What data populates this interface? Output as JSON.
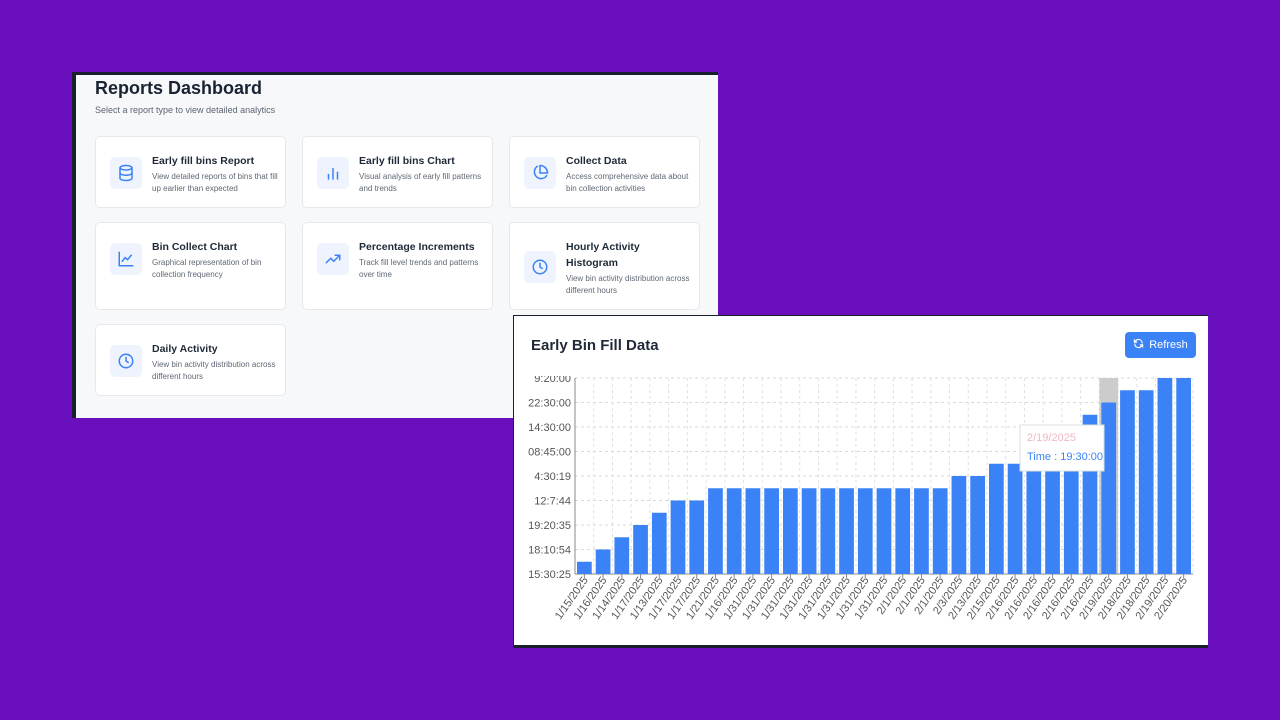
{
  "reports": {
    "title": "Reports Dashboard",
    "subtitle": "Select a report type to view detailed analytics",
    "cards": [
      {
        "title": "Early fill bins Report",
        "desc": "View detailed reports of bins that fill up earlier than expected",
        "icon": "database-icon"
      },
      {
        "title": "Early fill bins Chart",
        "desc": "Visual analysis of early fill patterns and trends",
        "icon": "bar-chart-icon"
      },
      {
        "title": "Collect Data",
        "desc": "Access comprehensive data about bin collection activities",
        "icon": "pie-chart-icon"
      },
      {
        "title": "Bin Collect Chart",
        "desc": "Graphical representation of bin collection frequency",
        "icon": "line-chart-icon"
      },
      {
        "title": "Percentage Increments",
        "desc": "Track fill level trends and patterns over time",
        "icon": "trending-up-icon"
      },
      {
        "title": "Hourly Activity Histogram",
        "desc": "View bin activity distribution across different hours",
        "icon": "clock-icon"
      },
      {
        "title": "Daily Activity",
        "desc": "View bin activity distribution across different hours",
        "icon": "clock-icon"
      }
    ]
  },
  "chart_panel": {
    "title": "Early Bin Fill Data",
    "refresh_label": "Refresh",
    "refresh_icon": "refresh-icon",
    "tooltip": {
      "date": "2/19/2025",
      "label": "Time : 19:30:00"
    }
  },
  "colors": {
    "bar": "#3b82f6",
    "accent": "#3b82f6",
    "background": "#6a0fbd"
  },
  "chart_data": {
    "type": "bar",
    "title": "Early Bin Fill Data",
    "y_tick_labels": [
      "15:30:25",
      "18:10:54",
      "19:20:35",
      "12:7:44",
      "4:30:19",
      "08:45:00",
      "14:30:00",
      "22:30:00",
      "9:20:00"
    ],
    "categories": [
      "1/15/2025",
      "1/16/2025",
      "1/14/2025",
      "1/17/2025",
      "1/13/2025",
      "1/17/2025",
      "1/17/2025",
      "1/21/2025",
      "1/16/2025",
      "1/31/2025",
      "1/31/2025",
      "1/31/2025",
      "1/31/2025",
      "1/31/2025",
      "1/31/2025",
      "1/31/2025",
      "1/31/2025",
      "2/1/2025",
      "2/1/2025",
      "2/1/2025",
      "2/3/2025",
      "2/13/2025",
      "2/15/2025",
      "2/16/2025",
      "2/16/2025",
      "2/16/2025",
      "2/16/2025",
      "2/16/2025",
      "2/19/2025",
      "2/18/2025",
      "2/18/2025",
      "2/19/2025",
      "2/20/2025"
    ],
    "values": [
      0.5,
      1,
      1.5,
      2,
      2.5,
      3,
      3,
      3.5,
      3.5,
      3.5,
      3.5,
      3.5,
      3.5,
      3.5,
      3.5,
      3.5,
      3.5,
      3.5,
      3.5,
      3.5,
      4,
      4,
      4.5,
      4.5,
      5,
      5.5,
      6,
      6.5,
      7,
      7.5,
      7.5,
      8,
      8
    ],
    "ylim": [
      0,
      8
    ],
    "highlighted_category_index": 28,
    "grid": true
  }
}
